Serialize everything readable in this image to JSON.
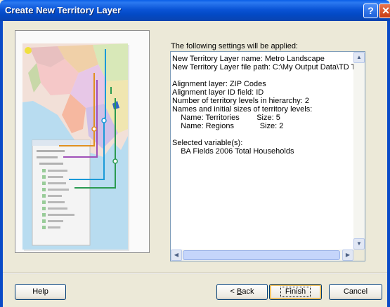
{
  "window": {
    "title": "Create New Territory Layer",
    "help_glyph": "?",
    "close_glyph": "✕"
  },
  "settings": {
    "caption": "The following settings will be applied:",
    "text": "New Territory Layer name: Metro Landscape\nNew Territory Layer file path: C:\\My Output Data\\TD T\n\nAlignment layer: ZIP Codes\nAlignment layer ID field: ID\nNumber of territory levels in hierarchy: 2\nNames and initial sizes of territory levels:\n    Name: Territories        Size: 5\n    Name: Regions            Size: 2\n\nSelected variable(s):\n    BA Fields 2006 Total Households"
  },
  "buttons": {
    "help": "Help",
    "back_prefix": "< ",
    "back_mnemonic": "B",
    "back_rest": "ack",
    "finish": "Finish",
    "cancel": "Cancel"
  },
  "icons": {
    "scroll_up": "▲",
    "scroll_down": "▼",
    "scroll_left": "◀",
    "scroll_right": "▶"
  },
  "colors": {
    "titlebar": "#0a54d6",
    "dialog_bg": "#ece9d8",
    "map_water": "#b8dcf0",
    "map_land": "#f2e0d8",
    "line_blue": "#1a9ad8",
    "line_purple": "#a050b8",
    "line_orange": "#e09020",
    "line_green": "#2a9a50"
  }
}
